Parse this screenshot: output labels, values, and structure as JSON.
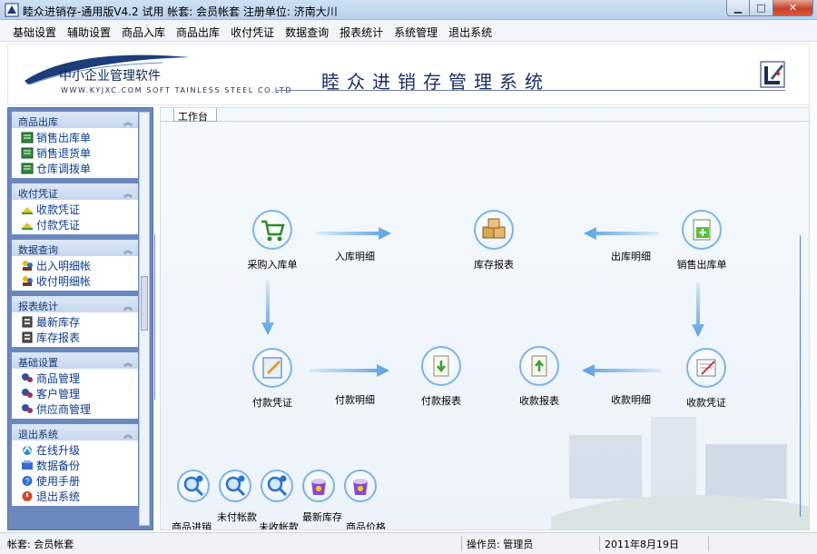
{
  "window": {
    "title": "睦众进销存-通用版V4.2 试用   帐套: 会员帐套 注册单位: 济南大川",
    "minimize_icon": "minimize-icon",
    "maximize_icon": "maximize-icon",
    "close_icon": "close-icon"
  },
  "menu": [
    {
      "label": "基础设置"
    },
    {
      "label": "辅助设置"
    },
    {
      "label": "商品入库"
    },
    {
      "label": "商品出库"
    },
    {
      "label": "收付凭证"
    },
    {
      "label": "数据查询"
    },
    {
      "label": "报表统计"
    },
    {
      "label": "系统管理"
    },
    {
      "label": "退出系统"
    }
  ],
  "banner": {
    "brand_name": "中小企业管理软件",
    "brand_url": "WWW.KYJXC.COM  SOFT  TAINLESS  STEEL  CO.LTD",
    "system_title": "睦众进销存管理系统"
  },
  "sidebar": {
    "panels": [
      {
        "title": "商品出库",
        "items": [
          {
            "label": "销售出库单",
            "icon": "ledger-icon"
          },
          {
            "label": "销售退货单",
            "icon": "ledger-icon"
          },
          {
            "label": "仓库调拨单",
            "icon": "ledger-icon"
          }
        ]
      },
      {
        "title": "收付凭证",
        "items": [
          {
            "label": "收款凭证",
            "icon": "money-icon"
          },
          {
            "label": "付款凭证",
            "icon": "money-icon"
          }
        ]
      },
      {
        "title": "数据查询",
        "items": [
          {
            "label": "出入明细帐",
            "icon": "users-icon"
          },
          {
            "label": "收付明细帐",
            "icon": "users-icon"
          }
        ]
      },
      {
        "title": "报表统计",
        "items": [
          {
            "label": "最新库存",
            "icon": "report-icon"
          },
          {
            "label": "库存报表",
            "icon": "report-icon"
          }
        ]
      },
      {
        "title": "基础设置",
        "items": [
          {
            "label": "商品管理",
            "icon": "settings-icon"
          },
          {
            "label": "客户管理",
            "icon": "settings-icon"
          },
          {
            "label": "供应商管理",
            "icon": "settings-icon"
          }
        ]
      },
      {
        "title": "退出系统",
        "items": [
          {
            "label": "在线升级",
            "icon": "upgrade-icon"
          },
          {
            "label": "数据备份",
            "icon": "backup-icon"
          },
          {
            "label": "使用手册",
            "icon": "help-icon"
          },
          {
            "label": "退出系统",
            "icon": "exit-icon"
          }
        ]
      }
    ]
  },
  "workspace": {
    "tab_label": "工作台",
    "nodes": {
      "purchase": "采购入库单",
      "inventory": "库存报表",
      "sales": "销售出库单",
      "payment": "付款凭证",
      "payment_report": "付款报表",
      "receipt_report": "收款报表",
      "receipt": "收款凭证"
    },
    "flows": {
      "in_detail": "入库明细",
      "out_detail": "出库明细",
      "pay_detail": "付款明细",
      "receive_detail": "收款明细"
    },
    "quick": {
      "item_1": "商品进销",
      "item_2": "未付帐款",
      "item_3": "未收帐款",
      "item_4": "最新库存",
      "item_5": "商品价格"
    }
  },
  "status": {
    "account": "帐套: 会员帐套",
    "operator": "操作员: 管理员",
    "date": "2011年8月19日"
  }
}
